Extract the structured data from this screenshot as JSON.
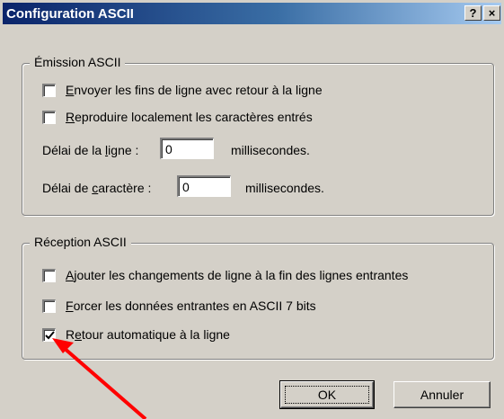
{
  "window": {
    "title": "Configuration ASCII",
    "help_button": "?",
    "close_button": "×"
  },
  "emission": {
    "group_title": "Émission ASCII",
    "send_line_ends": {
      "pre": "",
      "accel": "E",
      "post": "nvoyer les fins de ligne avec retour à la ligne",
      "checked": false
    },
    "echo_typed": {
      "pre": "",
      "accel": "R",
      "post": "eproduire localement les caractères entrés",
      "checked": false
    },
    "line_delay": {
      "pre": "Délai de la ",
      "accel": "l",
      "post": "igne :",
      "value": "0",
      "unit": "millisecondes."
    },
    "char_delay": {
      "pre": "Délai de ",
      "accel": "c",
      "post": "aractère :",
      "value": "0",
      "unit": "millisecondes."
    }
  },
  "reception": {
    "group_title": "Réception ASCII",
    "append_line_feeds": {
      "pre": "",
      "accel": "A",
      "post": "jouter les changements de ligne à la fin des lignes entrantes",
      "checked": false
    },
    "force_7bit": {
      "pre": "",
      "accel": "F",
      "post": "orcer les données entrantes en ASCII 7 bits",
      "checked": false
    },
    "wrap_lines": {
      "pre": "R",
      "accel": "e",
      "post": "tour automatique à la ligne",
      "checked": true
    }
  },
  "buttons": {
    "ok": "OK",
    "cancel": "Annuler"
  },
  "colors": {
    "dialog_bg": "#d4d0c8",
    "title_start": "#0a246a",
    "title_end": "#a6caf0",
    "annotation_arrow": "#ff0000"
  }
}
